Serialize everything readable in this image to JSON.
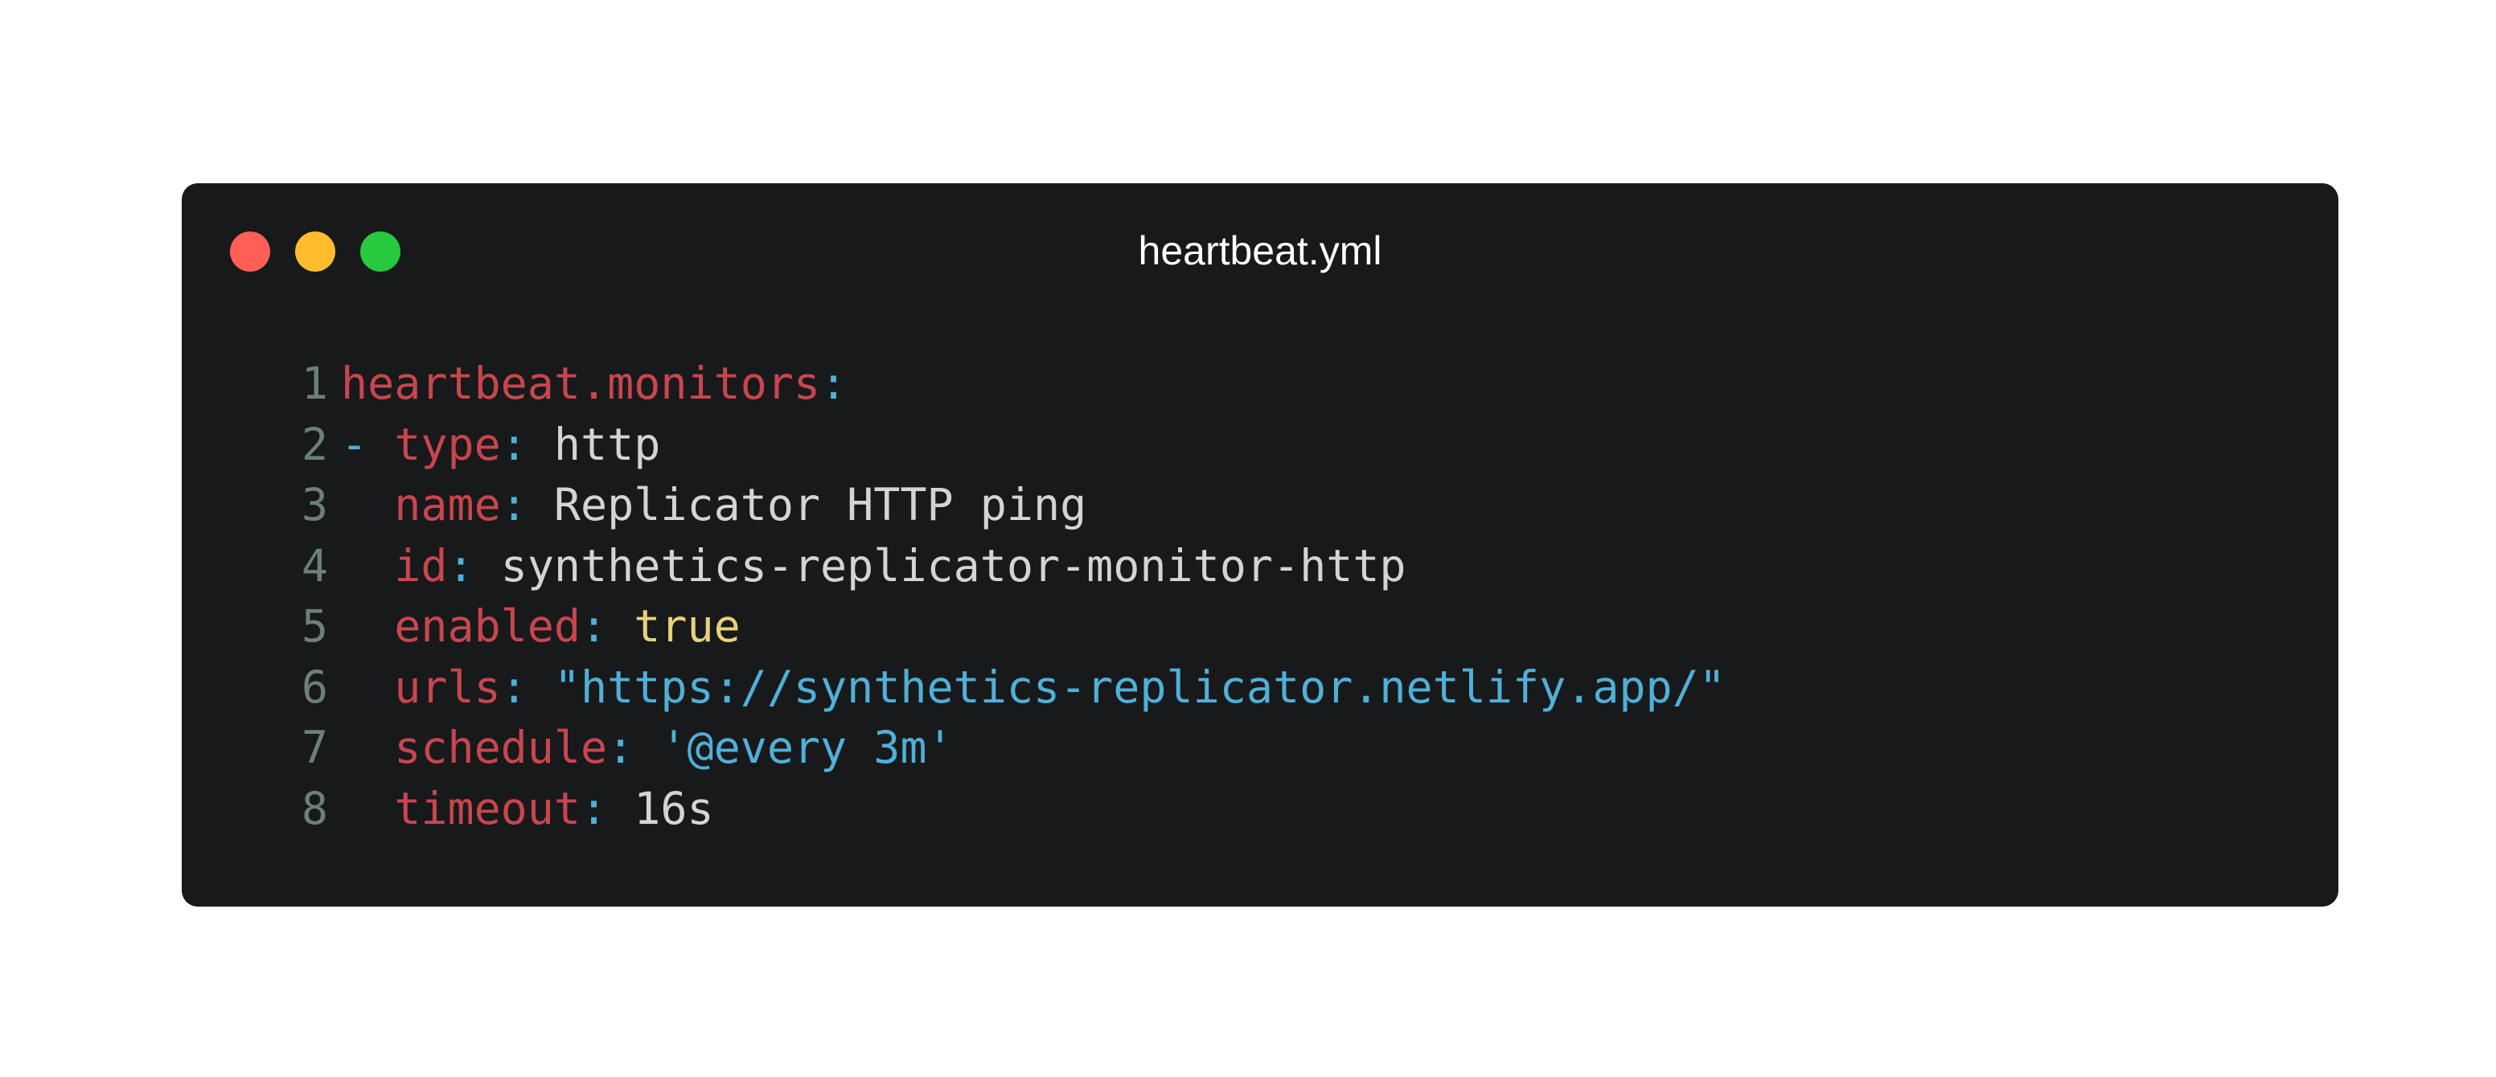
{
  "window": {
    "title": "heartbeat.yml",
    "controls": [
      {
        "name": "close",
        "color": "#ff5f56"
      },
      {
        "name": "minimize",
        "color": "#ffbd2e"
      },
      {
        "name": "maximize",
        "color": "#27c93f"
      }
    ]
  },
  "colors": {
    "line_number": "#6b8078",
    "key": "#c8464e",
    "punct": "#4fb0d9",
    "plain": "#d4d4d4",
    "string": "#4fb0d9",
    "boolean": "#e9d07a",
    "background": "#18191b"
  },
  "lines": [
    {
      "number": "1",
      "tokens": [
        {
          "t": "key",
          "v": "heartbeat.monitors"
        },
        {
          "t": "punct",
          "v": ":"
        }
      ]
    },
    {
      "number": "2",
      "tokens": [
        {
          "t": "punct",
          "v": "- "
        },
        {
          "t": "key",
          "v": "type"
        },
        {
          "t": "punct",
          "v": ": "
        },
        {
          "t": "plain",
          "v": "http"
        }
      ]
    },
    {
      "number": "3",
      "tokens": [
        {
          "t": "plain",
          "v": "  "
        },
        {
          "t": "key",
          "v": "name"
        },
        {
          "t": "punct",
          "v": ": "
        },
        {
          "t": "plain",
          "v": "Replicator HTTP ping"
        }
      ]
    },
    {
      "number": "4",
      "tokens": [
        {
          "t": "plain",
          "v": "  "
        },
        {
          "t": "key",
          "v": "id"
        },
        {
          "t": "punct",
          "v": ": "
        },
        {
          "t": "plain",
          "v": "synthetics-replicator-monitor-http"
        }
      ]
    },
    {
      "number": "5",
      "tokens": [
        {
          "t": "plain",
          "v": "  "
        },
        {
          "t": "key",
          "v": "enabled"
        },
        {
          "t": "punct",
          "v": ": "
        },
        {
          "t": "boolean",
          "v": "true"
        }
      ]
    },
    {
      "number": "6",
      "tokens": [
        {
          "t": "plain",
          "v": "  "
        },
        {
          "t": "key",
          "v": "urls"
        },
        {
          "t": "punct",
          "v": ": "
        },
        {
          "t": "string",
          "v": "\"https://synthetics-replicator.netlify.app/\""
        }
      ]
    },
    {
      "number": "7",
      "tokens": [
        {
          "t": "plain",
          "v": "  "
        },
        {
          "t": "key",
          "v": "schedule"
        },
        {
          "t": "punct",
          "v": ": "
        },
        {
          "t": "string",
          "v": "'@every 3m'"
        }
      ]
    },
    {
      "number": "8",
      "tokens": [
        {
          "t": "plain",
          "v": "  "
        },
        {
          "t": "key",
          "v": "timeout"
        },
        {
          "t": "punct",
          "v": ": "
        },
        {
          "t": "plain",
          "v": "16s"
        }
      ]
    }
  ]
}
